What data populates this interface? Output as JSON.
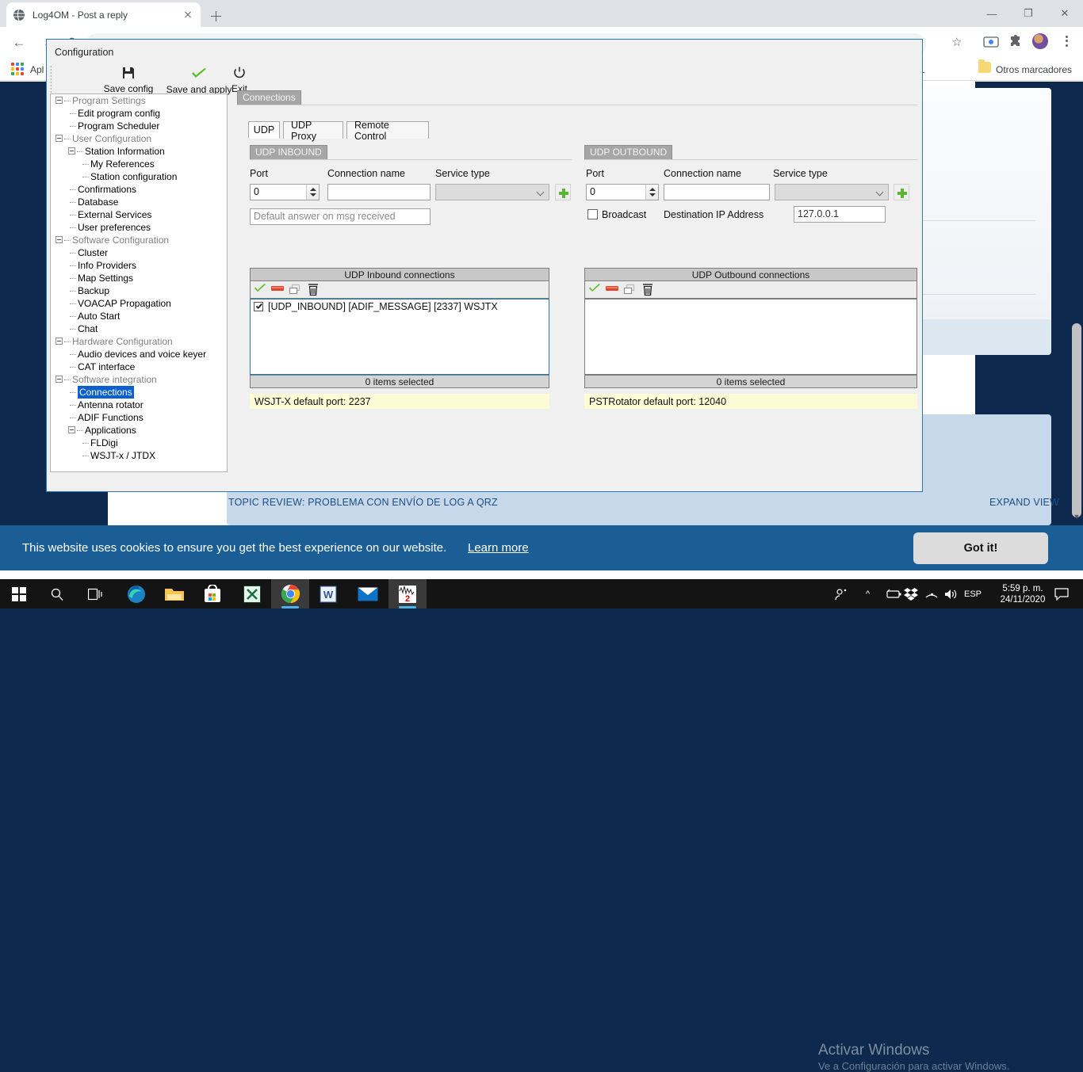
{
  "browser": {
    "tab": {
      "title": "Log4OM - Post a reply",
      "favicon": "globe-icon",
      "close": "×"
    },
    "new_tab_label": "+",
    "window_controls": {
      "minimize": "—",
      "maximize": "❐",
      "close": "✕"
    },
    "omnibox_value": "",
    "bookmarks": {
      "apps_label": "Apl",
      "other_bookmarks": "Otros marcadores",
      "visible_fragment": "L"
    }
  },
  "page": {
    "topic_review": "TOPIC REVIEW: PROBLEMA CON ENVÍO DE LOG A QRZ",
    "expand_view": "EXPAND VIEW",
    "cookie_text": "This website uses cookies to ensure you get the best experience on our website.",
    "cookie_link": "Learn more",
    "cookie_button": "Got it!",
    "watermark_title": "Activar Windows",
    "watermark_sub": "Ve a Configuración para activar Windows."
  },
  "taskbar": {
    "items": [
      {
        "name": "start-button",
        "glyph": "⊞"
      },
      {
        "name": "search-button",
        "glyph": "⌕"
      },
      {
        "name": "task-view-button",
        "glyph": "❑"
      },
      {
        "name": "edge-button",
        "glyph": ""
      },
      {
        "name": "file-explorer-button",
        "glyph": ""
      },
      {
        "name": "microsoft-store-button",
        "glyph": ""
      },
      {
        "name": "excel-button",
        "glyph": "X"
      },
      {
        "name": "chrome-button",
        "glyph": ""
      },
      {
        "name": "word-button",
        "glyph": "W"
      },
      {
        "name": "mail-button",
        "glyph": "✉"
      },
      {
        "name": "wsjtx-button",
        "glyph": ""
      }
    ],
    "tray": {
      "people": "",
      "chevron": "^",
      "battery": "",
      "dropbox": "",
      "wifi": "",
      "volume": "",
      "language": "ESP"
    },
    "clock_time": "5:59 p. m.",
    "clock_date": "24/11/2020",
    "action_center": "▢"
  },
  "config": {
    "window_title": "Configuration",
    "toolbar": [
      {
        "label": "Save config",
        "icon": "floppy-disk-icon"
      },
      {
        "label": "Save and apply",
        "icon": "green-check-icon"
      },
      {
        "label": "Exit",
        "icon": "power-icon"
      }
    ],
    "tree": [
      {
        "label": "Program Settings",
        "depth": 0,
        "expander": true,
        "gray": true,
        "selected": false
      },
      {
        "label": "Edit program config",
        "depth": 1,
        "expander": false,
        "gray": false,
        "selected": false
      },
      {
        "label": "Program Scheduler",
        "depth": 1,
        "expander": false,
        "gray": false,
        "selected": false
      },
      {
        "label": "User Configuration",
        "depth": 0,
        "expander": true,
        "gray": true,
        "selected": false
      },
      {
        "label": "Station Information",
        "depth": 1,
        "expander": true,
        "gray": false,
        "selected": false
      },
      {
        "label": "My References",
        "depth": 2,
        "expander": false,
        "gray": false,
        "selected": false
      },
      {
        "label": "Station configuration",
        "depth": 2,
        "expander": false,
        "gray": false,
        "selected": false
      },
      {
        "label": "Confirmations",
        "depth": 1,
        "expander": false,
        "gray": false,
        "selected": false
      },
      {
        "label": "Database",
        "depth": 1,
        "expander": false,
        "gray": false,
        "selected": false
      },
      {
        "label": "External Services",
        "depth": 1,
        "expander": false,
        "gray": false,
        "selected": false
      },
      {
        "label": "User preferences",
        "depth": 1,
        "expander": false,
        "gray": false,
        "selected": false
      },
      {
        "label": "Software Configuration",
        "depth": 0,
        "expander": true,
        "gray": true,
        "selected": false
      },
      {
        "label": "Cluster",
        "depth": 1,
        "expander": false,
        "gray": false,
        "selected": false
      },
      {
        "label": "Info Providers",
        "depth": 1,
        "expander": false,
        "gray": false,
        "selected": false
      },
      {
        "label": "Map Settings",
        "depth": 1,
        "expander": false,
        "gray": false,
        "selected": false
      },
      {
        "label": "Backup",
        "depth": 1,
        "expander": false,
        "gray": false,
        "selected": false
      },
      {
        "label": "VOACAP Propagation",
        "depth": 1,
        "expander": false,
        "gray": false,
        "selected": false
      },
      {
        "label": "Auto Start",
        "depth": 1,
        "expander": false,
        "gray": false,
        "selected": false
      },
      {
        "label": "Chat",
        "depth": 1,
        "expander": false,
        "gray": false,
        "selected": false
      },
      {
        "label": "Hardware Configuration",
        "depth": 0,
        "expander": true,
        "gray": true,
        "selected": false
      },
      {
        "label": "Audio devices and voice keyer",
        "depth": 1,
        "expander": false,
        "gray": false,
        "selected": false
      },
      {
        "label": "CAT interface",
        "depth": 1,
        "expander": false,
        "gray": false,
        "selected": false
      },
      {
        "label": "Software integration",
        "depth": 0,
        "expander": true,
        "gray": true,
        "selected": false
      },
      {
        "label": "Connections",
        "depth": 1,
        "expander": false,
        "gray": false,
        "selected": true
      },
      {
        "label": "Antenna rotator",
        "depth": 1,
        "expander": false,
        "gray": false,
        "selected": false
      },
      {
        "label": "ADIF Functions",
        "depth": 1,
        "expander": false,
        "gray": false,
        "selected": false
      },
      {
        "label": "Applications",
        "depth": 1,
        "expander": true,
        "gray": false,
        "selected": false
      },
      {
        "label": "FLDigi",
        "depth": 2,
        "expander": false,
        "gray": false,
        "selected": false
      },
      {
        "label": "WSJT-x / JTDX",
        "depth": 2,
        "expander": false,
        "gray": false,
        "selected": false
      }
    ],
    "group_label": "Connections",
    "tabs": [
      {
        "label": "UDP",
        "active": true
      },
      {
        "label": "UDP Proxy",
        "active": false
      },
      {
        "label": "Remote Control",
        "active": false
      }
    ],
    "inbound": {
      "section_label": "UDP INBOUND",
      "port_label": "Port",
      "port_value": "0",
      "connection_name_label": "Connection name",
      "connection_name_value": "",
      "service_type_label": "Service type",
      "service_type_value": "",
      "add_button": "add-icon",
      "default_answer_placeholder": "Default answer on msg received",
      "default_answer_value": "",
      "list_title": "UDP Inbound connections",
      "tools": [
        "enable-icon",
        "disable-icon",
        "duplicate-icon",
        "delete-icon"
      ],
      "items": [
        {
          "checked": true,
          "label": "[UDP_INBOUND] [ADIF_MESSAGE] [2337] WSJTX"
        }
      ],
      "status": "0 items selected",
      "note": "WSJT-X default port: 2237"
    },
    "outbound": {
      "section_label": "UDP OUTBOUND",
      "port_label": "Port",
      "port_value": "0",
      "connection_name_label": "Connection name",
      "connection_name_value": "",
      "service_type_label": "Service type",
      "service_type_value": "",
      "add_button": "add-icon",
      "broadcast_label": "Broadcast",
      "broadcast_checked": false,
      "dest_ip_label": "Destination IP Address",
      "dest_ip_value": "127.0.0.1",
      "list_title": "UDP Outbound connections",
      "tools": [
        "enable-icon",
        "disable-icon",
        "duplicate-icon",
        "delete-icon"
      ],
      "items": [],
      "status": "0 items selected",
      "note": "PSTRotator default port: 12040"
    }
  },
  "colors": {
    "accent_blue": "#2a7ab0",
    "selection_blue": "#0b5fd0",
    "note_yellow": "#fdfbd6",
    "forum_navy": "#0d2a4e",
    "cookie_blue": "#1b5e95",
    "green": "#5cb531"
  }
}
